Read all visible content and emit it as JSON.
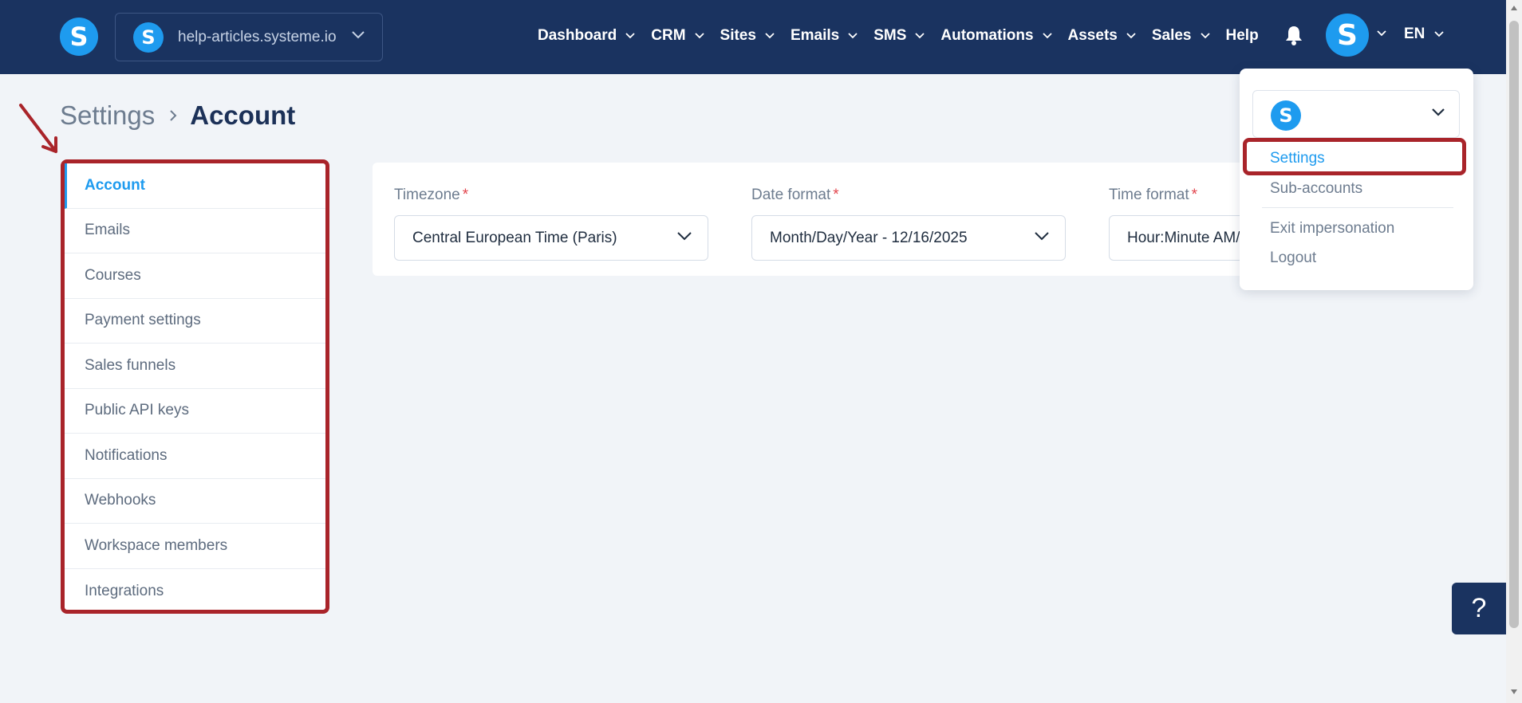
{
  "topbar": {
    "app_logo_letter": "S",
    "workspace": {
      "logo_letter": "S",
      "name": "help-articles.systeme.io"
    },
    "nav": [
      {
        "label": "Dashboard",
        "has_dropdown": true
      },
      {
        "label": "CRM",
        "has_dropdown": true
      },
      {
        "label": "Sites",
        "has_dropdown": true
      },
      {
        "label": "Emails",
        "has_dropdown": true
      },
      {
        "label": "SMS",
        "has_dropdown": true
      },
      {
        "label": "Automations",
        "has_dropdown": true
      },
      {
        "label": "Assets",
        "has_dropdown": true
      },
      {
        "label": "Sales",
        "has_dropdown": true
      },
      {
        "label": "Help",
        "has_dropdown": false
      }
    ],
    "notification_icon": "bell-icon",
    "user_avatar_letter": "S",
    "language": "EN"
  },
  "breadcrumb": {
    "parent": "Settings",
    "current": "Account"
  },
  "sidebar": {
    "items": [
      {
        "label": "Account",
        "active": true
      },
      {
        "label": "Emails",
        "active": false
      },
      {
        "label": "Courses",
        "active": false
      },
      {
        "label": "Payment settings",
        "active": false
      },
      {
        "label": "Sales funnels",
        "active": false
      },
      {
        "label": "Public API keys",
        "active": false
      },
      {
        "label": "Notifications",
        "active": false
      },
      {
        "label": "Webhooks",
        "active": false
      },
      {
        "label": "Workspace members",
        "active": false
      },
      {
        "label": "Integrations",
        "active": false
      }
    ]
  },
  "form": {
    "timezone": {
      "label": "Timezone",
      "required_mark": "*",
      "value": "Central European Time (Paris)"
    },
    "date_format": {
      "label": "Date format",
      "required_mark": "*",
      "value": "Month/Day/Year - 12/16/2025"
    },
    "time_format": {
      "label": "Time format",
      "required_mark": "*",
      "value": "Hour:Minute AM/PM"
    }
  },
  "user_menu": {
    "account_logo_letter": "S",
    "items": {
      "settings": "Settings",
      "sub_accounts": "Sub-accounts",
      "exit_impersonation": "Exit impersonation",
      "logout": "Logout"
    }
  },
  "help_button": "?",
  "colors": {
    "topbar": "#1a3360",
    "brand_blue": "#1e9bef",
    "highlight_red": "#a9242a",
    "required_red": "#e2434b"
  }
}
